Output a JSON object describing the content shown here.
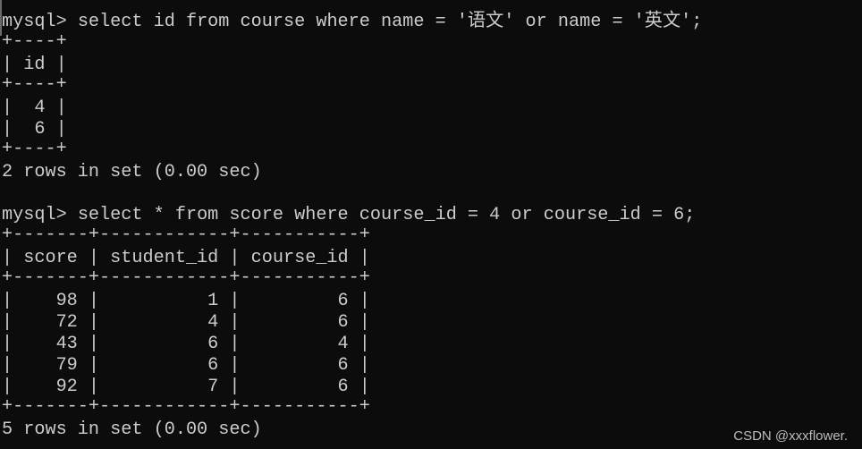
{
  "terminal": {
    "prompt": "mysql> ",
    "queries": [
      {
        "command": "select id from course where name = '语文' or name = '英文';",
        "columns": [
          "id"
        ],
        "border": "+----+",
        "header_line": "| id |",
        "rows": [
          [
            "4"
          ],
          [
            "6"
          ]
        ],
        "row_lines": [
          "|  4 |",
          "|  6 |"
        ],
        "result_summary": "2 rows in set (0.00 sec)"
      },
      {
        "command": "select * from score where course_id = 4 or course_id = 6;",
        "columns": [
          "score",
          "student_id",
          "course_id"
        ],
        "border": "+-------+------------+-----------+",
        "header_line": "| score | student_id | course_id |",
        "rows": [
          [
            "98",
            "1",
            "6"
          ],
          [
            "72",
            "4",
            "6"
          ],
          [
            "43",
            "6",
            "4"
          ],
          [
            "79",
            "6",
            "6"
          ],
          [
            "92",
            "7",
            "6"
          ]
        ],
        "row_lines": [
          "|    98 |          1 |         6 |",
          "|    72 |          4 |         6 |",
          "|    43 |          6 |         4 |",
          "|    79 |          6 |         6 |",
          "|    92 |          7 |         6 |"
        ],
        "result_summary": "5 rows in set (0.00 sec)"
      }
    ],
    "colors": {
      "background": "#0c0c0c",
      "foreground": "#cccccc"
    }
  },
  "watermark": "CSDN @xxxflower."
}
